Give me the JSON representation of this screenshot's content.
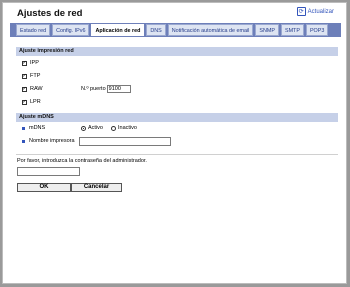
{
  "header": {
    "title": "Ajustes de red",
    "refresh_label": "Actualizar"
  },
  "tabs": [
    {
      "label": "Estado red"
    },
    {
      "label": "Config. IPv6"
    },
    {
      "label": "Aplicación de red"
    },
    {
      "label": "DNS"
    },
    {
      "label": "Notificación automática de email"
    },
    {
      "label": "SNMP"
    },
    {
      "label": "SMTP"
    },
    {
      "label": "POP3"
    }
  ],
  "print_section": {
    "title": "Ajuste impresión red",
    "protocols": [
      {
        "label": "IPP",
        "checked": true
      },
      {
        "label": "FTP",
        "checked": true
      },
      {
        "label": "RAW",
        "checked": true
      },
      {
        "label": "LPR",
        "checked": true
      }
    ],
    "port_label": "N.º puerto",
    "port_value": "9100"
  },
  "mdns_section": {
    "title": "Ajuste mDNS",
    "mdns_label": "mDNS",
    "active_label": "Activo",
    "inactive_label": "Inactivo",
    "selected": "Activo",
    "printer_name_label": "Nombre impresora",
    "printer_name_value": ""
  },
  "admin": {
    "prompt": "Por favor, introduzca la contraseña del administrador.",
    "password_value": ""
  },
  "buttons": {
    "ok": "OK",
    "cancel": "Cancelar"
  }
}
